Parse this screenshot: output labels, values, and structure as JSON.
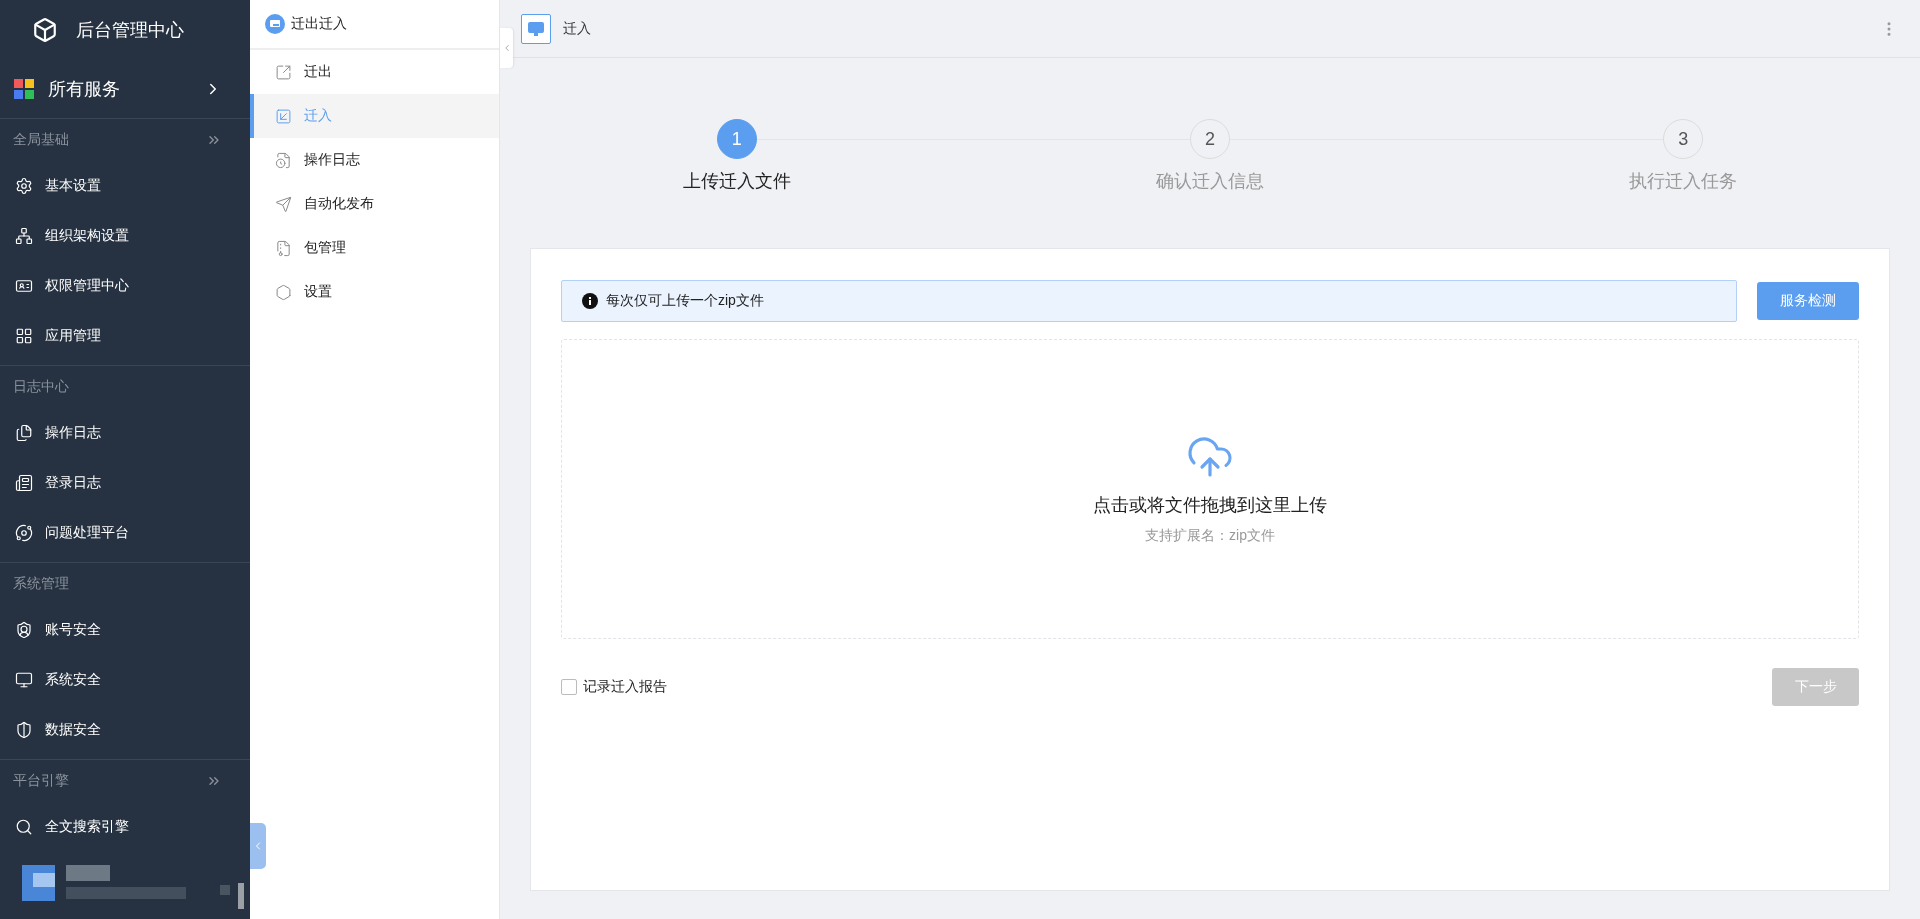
{
  "app": {
    "title": "后台管理中心"
  },
  "services": {
    "label": "所有服务"
  },
  "sidebar": {
    "groups": [
      {
        "title": "全局基础",
        "collapsible": true,
        "items": [
          {
            "label": "基本设置"
          },
          {
            "label": "组织架构设置"
          },
          {
            "label": "权限管理中心"
          },
          {
            "label": "应用管理"
          }
        ]
      },
      {
        "title": "日志中心",
        "collapsible": false,
        "items": [
          {
            "label": "操作日志"
          },
          {
            "label": "登录日志"
          },
          {
            "label": "问题处理平台"
          }
        ]
      },
      {
        "title": "系统管理",
        "collapsible": false,
        "items": [
          {
            "label": "账号安全"
          },
          {
            "label": "系统安全"
          },
          {
            "label": "数据安全"
          }
        ]
      },
      {
        "title": "平台引擎",
        "collapsible": true,
        "items": [
          {
            "label": "全文搜索引擎"
          }
        ]
      }
    ]
  },
  "subnav": {
    "title": "迁出迁入",
    "items": [
      {
        "label": "迁出",
        "selected": false
      },
      {
        "label": "迁入",
        "selected": true
      },
      {
        "label": "操作日志",
        "selected": false
      },
      {
        "label": "自动化发布",
        "selected": false
      },
      {
        "label": "包管理",
        "selected": false
      },
      {
        "label": "设置",
        "selected": false
      }
    ]
  },
  "page": {
    "title": "迁入"
  },
  "steps": [
    {
      "number": "1",
      "label": "上传迁入文件",
      "selected": true
    },
    {
      "number": "2",
      "label": "确认迁入信息",
      "selected": false
    },
    {
      "number": "3",
      "label": "执行迁入任务",
      "selected": false
    }
  ],
  "notice": "每次仅可上传一个zip文件",
  "check_button": "服务检测",
  "upload": {
    "title": "点击或将文件拖拽到这里上传",
    "hint": "支持扩展名：zip文件"
  },
  "record_report": {
    "label": "记录迁入报告",
    "checked": false
  },
  "next_button": {
    "label": "下一步",
    "disabled": true
  }
}
